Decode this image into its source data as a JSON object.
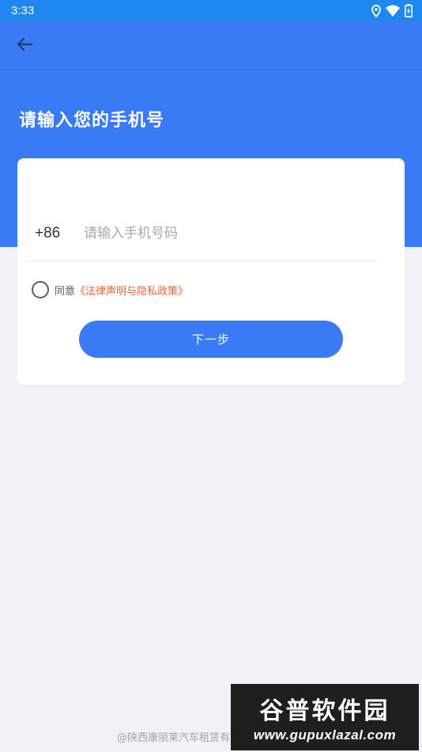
{
  "status_bar": {
    "time": "3:33",
    "icons": [
      "location-icon",
      "wifi-icon",
      "battery-charging-icon"
    ]
  },
  "toolbar": {
    "back_icon": "arrow-left-icon"
  },
  "page": {
    "title": "请输入您的手机号"
  },
  "form": {
    "country_code": "+86",
    "phone_placeholder": "请输入手机号码",
    "phone_value": "",
    "agree_label": "同意",
    "policy_link": "《法律声明与隐私政策》",
    "agreed": false,
    "next_button": "下一步"
  },
  "footer": {
    "company": "@陕西康丽莱汽车租赁有"
  },
  "watermark": {
    "title": "谷普软件园",
    "url": "www.gupuxlazal.com"
  },
  "colors": {
    "primary": "#3a7af4",
    "status_bar": "#1e88f0",
    "link": "#e0673a",
    "background": "#f1f2f7"
  }
}
